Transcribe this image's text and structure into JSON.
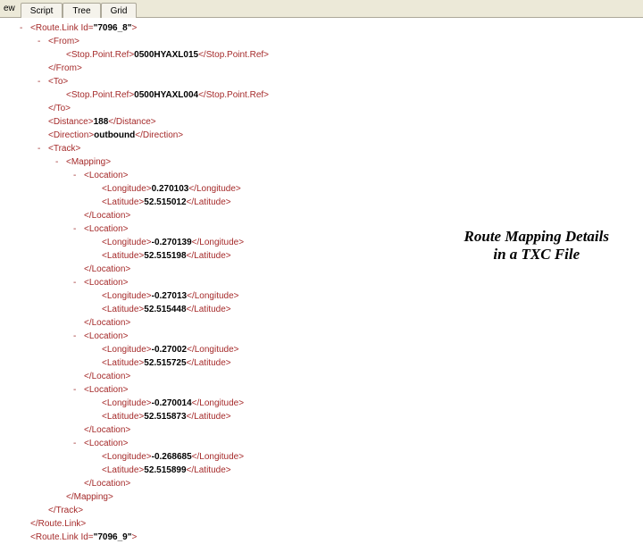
{
  "toolbar": {
    "view_label": "ew",
    "tabs": [
      "Script",
      "Tree",
      "Grid"
    ]
  },
  "annotation": {
    "line1": "Route Mapping Details",
    "line2": "in a TXC File"
  },
  "xml": {
    "routelink_open_name": "Route.Link",
    "routelink_attr": "Id",
    "routelink_attr_val": "\"7096_8\"",
    "from_open": "<From>",
    "stoppoint_open": "<Stop.Point.Ref>",
    "stoppoint_close": "</Stop.Point.Ref>",
    "from_spr": "0500HYAXL015",
    "from_close": "</From>",
    "to_open": "<To>",
    "to_spr": "0500HYAXL004",
    "to_close": "</To>",
    "distance_open": "<Distance>",
    "distance_val": "188",
    "distance_close": "</Distance>",
    "direction_open": "<Direction>",
    "direction_val": "outbound",
    "direction_close": "</Direction>",
    "track_open": "<Track>",
    "mapping_open": "<Mapping>",
    "location_open": "<Location>",
    "longitude_open": "<Longitude>",
    "longitude_close": "</Longitude>",
    "latitude_open": "<Latitude>",
    "latitude_close": "</Latitude>",
    "location_close": "</Location>",
    "loc1_lon": " 0.270103",
    "loc1_lat": "52.515012",
    "loc2_lon": "-0.270139",
    "loc2_lat": "52.515198",
    "loc3_lon": "-0.27013",
    "loc3_lat": "52.515448",
    "loc4_lon": "-0.27002",
    "loc4_lat": "52.515725",
    "loc5_lon": "-0.270014",
    "loc5_lat": "52.515873",
    "loc6_lon": "-0.268685",
    "loc6_lat": "52.515899",
    "mapping_close": "</Mapping>",
    "track_close": "</Track>",
    "routelink_close": "</Route.Link>",
    "routelink2_attr_val": "\"7096_9\""
  }
}
